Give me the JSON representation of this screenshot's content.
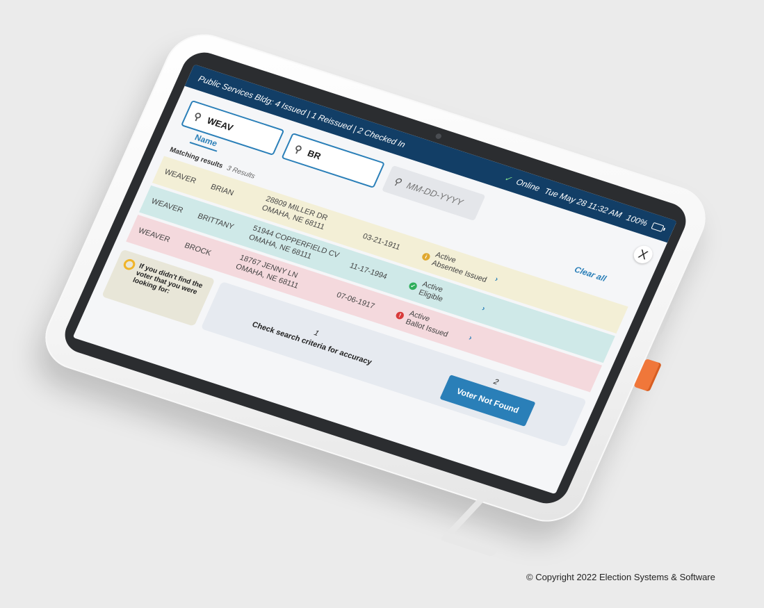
{
  "status_bar": {
    "location_summary": "Public Services Bldg: 4 Issued | 1 Reissued | 2 Checked In",
    "online": "Online",
    "datetime": "Tue May 28 11:32 AM",
    "battery": "100%"
  },
  "search": {
    "last_name_value": "WEAV",
    "first_name_value": "BR",
    "dob_placeholder": "MM-DD-YYYY",
    "tab_label": "Name",
    "clear_all": "Clear all",
    "close_label": "X"
  },
  "results": {
    "label": "Matching results",
    "count": "3 Results",
    "rows": [
      {
        "last": "WEAVER",
        "first": "BRIAN",
        "address_line1": "28809 MILLER DR",
        "address_line2": "OMAHA, NE 68111",
        "dob": "03-21-1911",
        "status_line1": "Active",
        "status_line2": "Absentee Issued",
        "color": "#f3efd6",
        "icon_color": "#e0a82e"
      },
      {
        "last": "WEAVER",
        "first": "BRITTANY",
        "address_line1": "51944 COPPERFIELD CV",
        "address_line2": "OMAHA, NE 68111",
        "dob": "11-17-1994",
        "status_line1": "Active",
        "status_line2": "Eligible",
        "color": "#cfe9e8",
        "icon_color": "#2fae5b"
      },
      {
        "last": "WEAVER",
        "first": "BROCK",
        "address_line1": "18767 JENNY LN",
        "address_line2": "OMAHA, NE 68111",
        "dob": "07-06-1917",
        "status_line1": "Active",
        "status_line2": "Ballot Issued",
        "color": "#f4d9dd",
        "icon_color": "#d83a3a"
      }
    ]
  },
  "help": {
    "prompt": "If you didn't find the voter that you were looking for:",
    "step1_num": "1",
    "step1_text": "Check search criteria for accuracy",
    "step2_num": "2",
    "step2_button": "Voter Not Found"
  },
  "copyright": "© Copyright 2022 Election Systems & Software"
}
